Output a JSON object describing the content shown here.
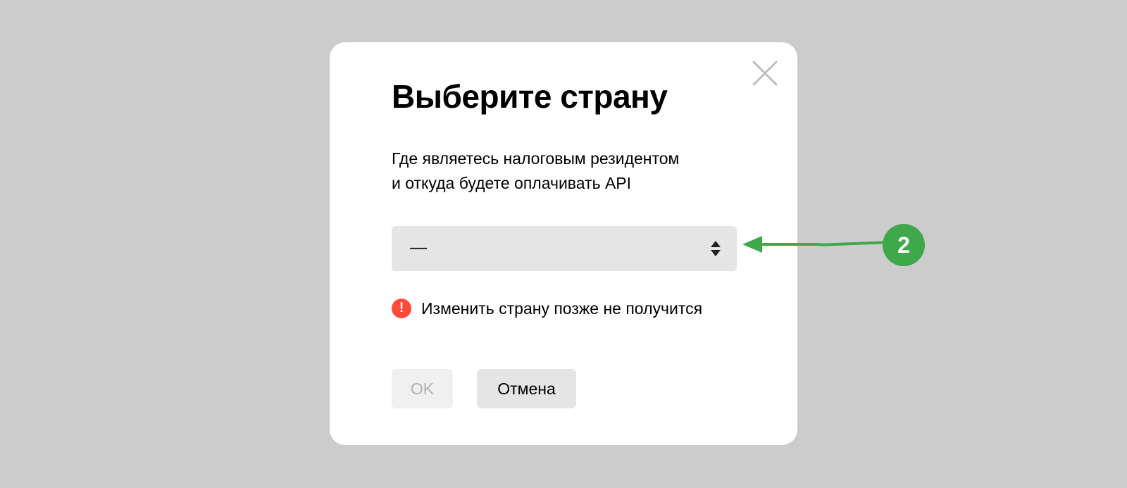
{
  "dialog": {
    "title": "Выберите страну",
    "subtitle_line1": "Где являетесь налоговым резидентом",
    "subtitle_line2": "и откуда будете оплачивать API",
    "country_select": {
      "value": "—",
      "icon": "updown-arrows-icon"
    },
    "warning": {
      "icon_symbol": "!",
      "icon": "exclamation-circle-icon",
      "text": "Изменить страну позже не получится",
      "color": "#ff4b3a"
    },
    "ok_label": "OK",
    "cancel_label": "Отмена",
    "close_icon": "close-icon"
  },
  "annotation": {
    "step_number": "2",
    "color": "#3fa84a"
  },
  "colors": {
    "backdrop": "#cccccc",
    "modal": "#ffffff",
    "select_bg": "#e5e5e5",
    "ok_disabled_bg": "#f0f0f0",
    "ok_disabled_text": "#b3b3b3"
  }
}
